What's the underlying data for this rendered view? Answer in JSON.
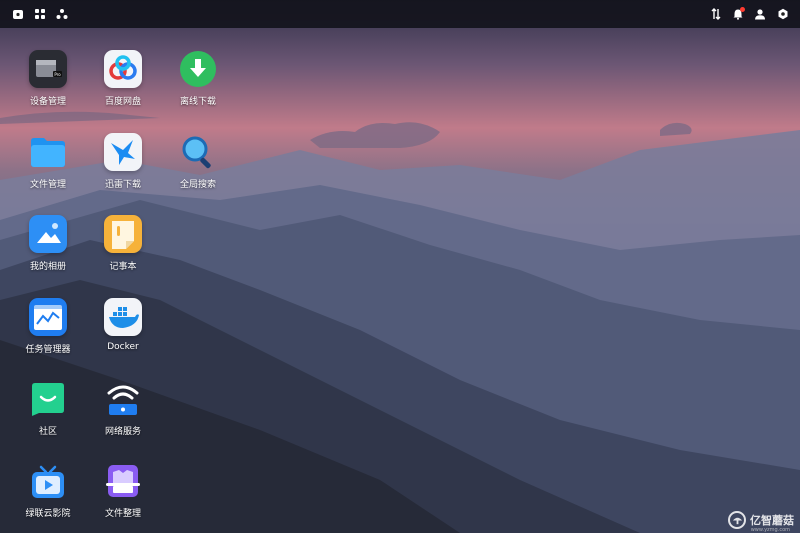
{
  "topbar": {
    "left_icons": [
      "home-icon",
      "apps-grid-icon",
      "cluster-icon"
    ],
    "right_icons": [
      "transfer-icon",
      "bell-icon",
      "user-icon",
      "settings-icon"
    ],
    "notification_color": "#ff3b30"
  },
  "apps": [
    {
      "label": "设备管理",
      "icon": "device-manager-icon"
    },
    {
      "label": "百度网盘",
      "icon": "baidu-netdisk-icon"
    },
    {
      "label": "离线下载",
      "icon": "offline-download-icon"
    },
    {
      "label": "文件管理",
      "icon": "file-manager-icon"
    },
    {
      "label": "迅雷下载",
      "icon": "thunder-download-icon"
    },
    {
      "label": "全局搜索",
      "icon": "global-search-icon"
    },
    {
      "label": "我的相册",
      "icon": "photo-album-icon"
    },
    {
      "label": "记事本",
      "icon": "notepad-icon"
    },
    {
      "label": "任务管理器",
      "icon": "task-manager-icon"
    },
    {
      "label": "Docker",
      "icon": "docker-icon"
    },
    {
      "label": "社区",
      "icon": "community-icon"
    },
    {
      "label": "网络服务",
      "icon": "network-service-icon"
    },
    {
      "label": "绿联云影院",
      "icon": "cinema-icon"
    },
    {
      "label": "文件整理",
      "icon": "file-organize-icon"
    }
  ],
  "watermark": {
    "text": "亿智蘑菇",
    "sub": "www.yzmg.com"
  }
}
